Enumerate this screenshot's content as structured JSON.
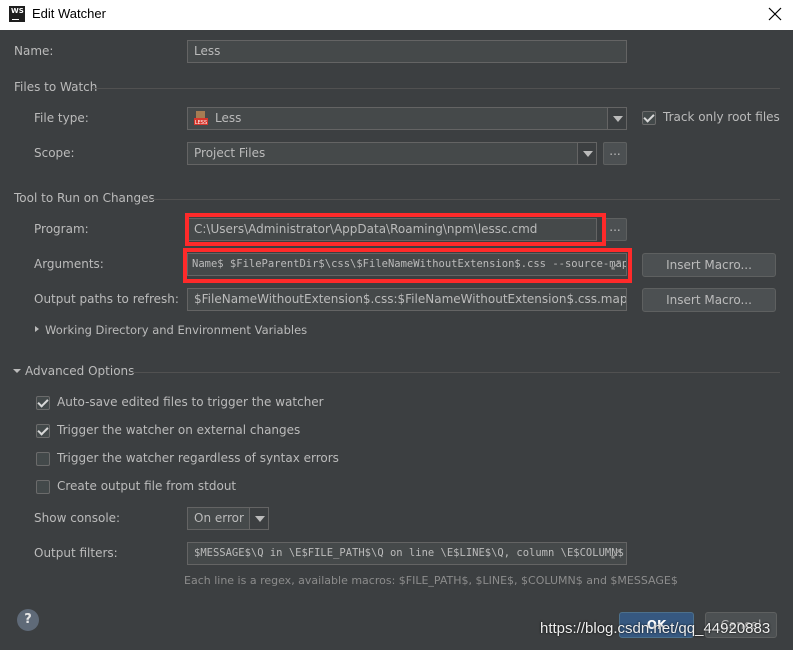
{
  "window": {
    "title": "Edit Watcher",
    "app_icon_text": "WS"
  },
  "name": {
    "label": "Name:",
    "value": "Less"
  },
  "files_to_watch": {
    "heading": "Files to Watch",
    "file_type_label": "File type:",
    "file_type_value": "Less",
    "file_type_icon": "less-file-icon",
    "track_only_root": {
      "label": "Track only root files",
      "checked": true
    },
    "scope_label": "Scope:",
    "scope_value": "Project Files",
    "scope_more": "..."
  },
  "tool": {
    "heading": "Tool to Run on Changes",
    "program_label": "Program:",
    "program_value": "C:\\Users\\Administrator\\AppData\\Roaming\\npm\\lessc.cmd",
    "program_more": "...",
    "arguments_label": "Arguments:",
    "arguments_value": "Name$ $FileParentDir$\\css\\$FileNameWithoutExtension$.css --source-map",
    "output_paths_label": "Output paths to refresh:",
    "output_paths_value": "$FileNameWithoutExtension$.css:$FileNameWithoutExtension$.css.map",
    "insert_macro_1": "Insert Macro...",
    "insert_macro_2": "Insert Macro...",
    "working_dir_label": "Working Directory and Environment Variables"
  },
  "advanced": {
    "heading": "Advanced Options",
    "auto_save": {
      "label": "Auto-save edited files to trigger the watcher",
      "checked": true
    },
    "external_changes": {
      "label": "Trigger the watcher on external changes",
      "checked": true
    },
    "regardless_syntax": {
      "label": "Trigger the watcher regardless of syntax errors",
      "checked": false
    },
    "create_output": {
      "label": "Create output file from stdout",
      "checked": false
    },
    "show_console_label": "Show console:",
    "show_console_value": "On error",
    "output_filters_label": "Output filters:",
    "output_filters_value": "$MESSAGE$\\Q in \\E$FILE_PATH$\\Q on line \\E$LINE$\\Q, column \\E$COLUMN$",
    "hint": "Each line is a regex, available macros: $FILE_PATH$, $LINE$, $COLUMN$ and $MESSAGE$"
  },
  "footer": {
    "help": "?",
    "ok": "OK",
    "cancel": "Cancel",
    "watermark": "https://blog.csdn.net/qq_44920883"
  },
  "colors": {
    "background": "#3c3f41",
    "field": "#45494a",
    "highlight_box": "#ff2a2a",
    "ok_button": "#365880"
  }
}
